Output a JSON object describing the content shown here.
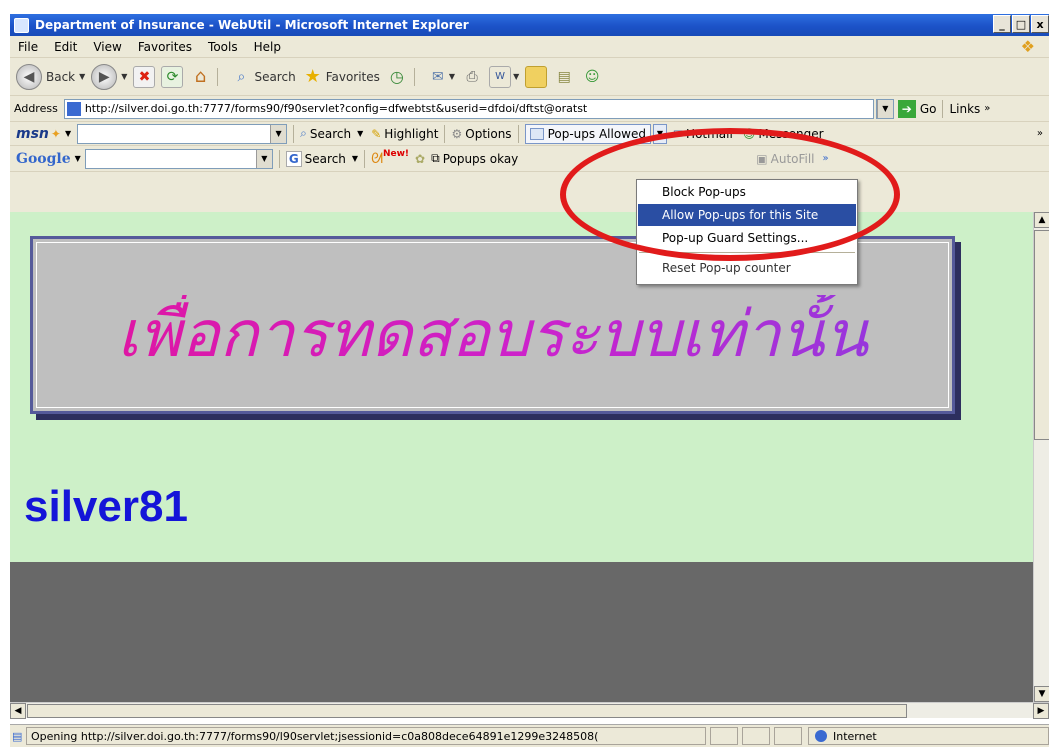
{
  "window": {
    "title": "Department of Insurance - WebUtil - Microsoft Internet Explorer",
    "buttons": [
      "_",
      "□",
      "x"
    ]
  },
  "menubar": [
    "File",
    "Edit",
    "View",
    "Favorites",
    "Tools",
    "Help"
  ],
  "toolbar": {
    "back": "Back",
    "search": "Search",
    "favorites": "Favorites"
  },
  "address": {
    "label": "Address",
    "url": "http://silver.doi.go.th:7777/forms90/f90servlet?config=dfwebtst&userid=dfdoi/dftst@oratst",
    "go": "Go",
    "links": "Links"
  },
  "msn": {
    "logo": "msn",
    "search": "Search",
    "highlight": "Highlight",
    "options": "Options",
    "popups": "Pop-ups Allowed",
    "hotmail": "Hotmail",
    "messenger": "Messenger"
  },
  "google": {
    "logo": "Google",
    "search": "Search",
    "new_badge": "New!",
    "popups_okay": "Popups okay",
    "autofill": "AutoFill"
  },
  "popup_menu": {
    "items": [
      "Block Pop-ups",
      "Allow Pop-ups for this Site",
      "Pop-up Guard Settings...",
      "Reset Pop-up counter"
    ],
    "highlighted_index": 1
  },
  "content": {
    "banner_text": "เพื่อการทดสอบระบบเท่านั้น",
    "server_name": "silver81"
  },
  "status": {
    "text": "Opening http://silver.doi.go.th:7777/forms90/l90servlet;jsessionid=c0a808dece64891e1299e3248508(",
    "zone": "Internet"
  },
  "colors": {
    "content_bg": "#cdf0c8",
    "server_name": "#1414d8",
    "annotation": "#e11b1b",
    "menu_highlight": "#2a4ea3"
  }
}
